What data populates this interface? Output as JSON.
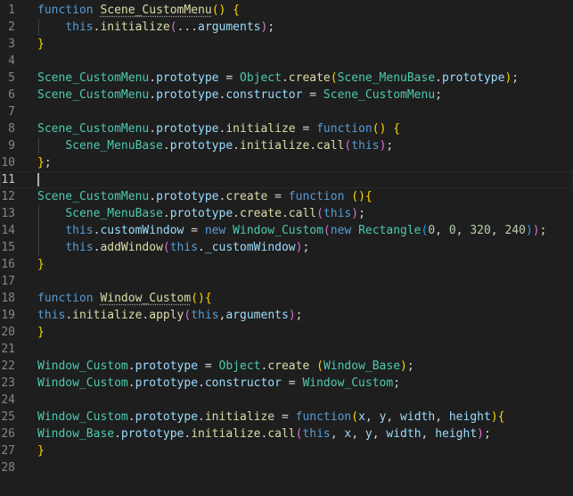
{
  "editor": {
    "current_line": 11,
    "lines": [
      {
        "n": "1",
        "t": [
          [
            "function ",
            "kw"
          ],
          [
            "Scene_CustomMenu",
            "fn dotted"
          ],
          [
            "(",
            "br1"
          ],
          [
            ")",
            "br1"
          ],
          [
            " ",
            "pun"
          ],
          [
            "{",
            "br1"
          ]
        ]
      },
      {
        "n": "2",
        "indent": 1,
        "t": [
          [
            "    ",
            "pun"
          ],
          [
            "this",
            "kw"
          ],
          [
            ".",
            "pun"
          ],
          [
            "initialize",
            "fn"
          ],
          [
            "(",
            "br2"
          ],
          [
            "...",
            "pun"
          ],
          [
            "arguments",
            "prop"
          ],
          [
            ")",
            "br2"
          ],
          [
            ";",
            "pun"
          ]
        ]
      },
      {
        "n": "3",
        "t": [
          [
            "}",
            "br1"
          ]
        ]
      },
      {
        "n": "4",
        "t": []
      },
      {
        "n": "5",
        "t": [
          [
            "Scene_CustomMenu",
            "cls"
          ],
          [
            ".",
            "pun"
          ],
          [
            "prototype",
            "prop"
          ],
          [
            " = ",
            "pun"
          ],
          [
            "Object",
            "cls"
          ],
          [
            ".",
            "pun"
          ],
          [
            "create",
            "fn"
          ],
          [
            "(",
            "br1"
          ],
          [
            "Scene_MenuBase",
            "cls"
          ],
          [
            ".",
            "pun"
          ],
          [
            "prototype",
            "prop"
          ],
          [
            ")",
            "br1"
          ],
          [
            ";",
            "pun"
          ]
        ]
      },
      {
        "n": "6",
        "t": [
          [
            "Scene_CustomMenu",
            "cls"
          ],
          [
            ".",
            "pun"
          ],
          [
            "prototype",
            "prop"
          ],
          [
            ".",
            "pun"
          ],
          [
            "constructor",
            "prop"
          ],
          [
            " = ",
            "pun"
          ],
          [
            "Scene_CustomMenu",
            "cls"
          ],
          [
            ";",
            "pun"
          ]
        ]
      },
      {
        "n": "7",
        "t": []
      },
      {
        "n": "8",
        "t": [
          [
            "Scene_CustomMenu",
            "cls"
          ],
          [
            ".",
            "pun"
          ],
          [
            "prototype",
            "prop"
          ],
          [
            ".",
            "pun"
          ],
          [
            "initialize",
            "fn"
          ],
          [
            " = ",
            "pun"
          ],
          [
            "function",
            "kw"
          ],
          [
            "(",
            "br1"
          ],
          [
            ")",
            "br1"
          ],
          [
            " ",
            "pun"
          ],
          [
            "{",
            "br1"
          ]
        ]
      },
      {
        "n": "9",
        "indent": 1,
        "t": [
          [
            "    ",
            "pun"
          ],
          [
            "Scene_MenuBase",
            "cls"
          ],
          [
            ".",
            "pun"
          ],
          [
            "prototype",
            "prop"
          ],
          [
            ".",
            "pun"
          ],
          [
            "initialize",
            "fn"
          ],
          [
            ".",
            "pun"
          ],
          [
            "call",
            "fn"
          ],
          [
            "(",
            "br2"
          ],
          [
            "this",
            "kw"
          ],
          [
            ")",
            "br2"
          ],
          [
            ";",
            "pun"
          ]
        ]
      },
      {
        "n": "10",
        "t": [
          [
            "}",
            "br1"
          ],
          [
            ";",
            "pun"
          ]
        ]
      },
      {
        "n": "11",
        "cursor": true,
        "t": []
      },
      {
        "n": "12",
        "t": [
          [
            "Scene_CustomMenu",
            "cls"
          ],
          [
            ".",
            "pun"
          ],
          [
            "prototype",
            "prop"
          ],
          [
            ".",
            "pun"
          ],
          [
            "create",
            "fn"
          ],
          [
            " = ",
            "pun"
          ],
          [
            "function",
            "kw"
          ],
          [
            " ",
            "pun"
          ],
          [
            "(",
            "br1"
          ],
          [
            ")",
            "br1"
          ],
          [
            "{",
            "br1"
          ]
        ]
      },
      {
        "n": "13",
        "indent": 1,
        "t": [
          [
            "    ",
            "pun"
          ],
          [
            "Scene_MenuBase",
            "cls"
          ],
          [
            ".",
            "pun"
          ],
          [
            "prototype",
            "prop"
          ],
          [
            ".",
            "pun"
          ],
          [
            "create",
            "fn"
          ],
          [
            ".",
            "pun"
          ],
          [
            "call",
            "fn"
          ],
          [
            "(",
            "br2"
          ],
          [
            "this",
            "kw"
          ],
          [
            ")",
            "br2"
          ],
          [
            ";",
            "pun"
          ]
        ]
      },
      {
        "n": "14",
        "indent": 1,
        "t": [
          [
            "    ",
            "pun"
          ],
          [
            "this",
            "kw"
          ],
          [
            ".",
            "pun"
          ],
          [
            "customWindow",
            "prop"
          ],
          [
            " = ",
            "pun"
          ],
          [
            "new ",
            "kw"
          ],
          [
            "Window_Custom",
            "cls"
          ],
          [
            "(",
            "br2"
          ],
          [
            "new ",
            "kw"
          ],
          [
            "Rectangle",
            "cls"
          ],
          [
            "(",
            "br3"
          ],
          [
            "0",
            "num"
          ],
          [
            ", ",
            "pun"
          ],
          [
            "0",
            "num"
          ],
          [
            ", ",
            "pun"
          ],
          [
            "320",
            "num"
          ],
          [
            ", ",
            "pun"
          ],
          [
            "240",
            "num"
          ],
          [
            ")",
            "br3"
          ],
          [
            ")",
            "br2"
          ],
          [
            ";",
            "pun"
          ]
        ]
      },
      {
        "n": "15",
        "indent": 1,
        "t": [
          [
            "    ",
            "pun"
          ],
          [
            "this",
            "kw"
          ],
          [
            ".",
            "pun"
          ],
          [
            "addWindow",
            "fn"
          ],
          [
            "(",
            "br2"
          ],
          [
            "this",
            "kw"
          ],
          [
            ".",
            "pun"
          ],
          [
            "_customWindow",
            "prop"
          ],
          [
            ")",
            "br2"
          ],
          [
            ";",
            "pun"
          ]
        ]
      },
      {
        "n": "16",
        "t": [
          [
            "}",
            "br1"
          ]
        ]
      },
      {
        "n": "17",
        "t": []
      },
      {
        "n": "18",
        "t": [
          [
            "function ",
            "kw"
          ],
          [
            "Window_Custom",
            "fn dotted"
          ],
          [
            "(",
            "br1"
          ],
          [
            ")",
            "br1"
          ],
          [
            "{",
            "br1"
          ]
        ]
      },
      {
        "n": "19",
        "t": [
          [
            "this",
            "kw"
          ],
          [
            ".",
            "pun"
          ],
          [
            "initialize",
            "fn"
          ],
          [
            ".",
            "pun"
          ],
          [
            "apply",
            "fn"
          ],
          [
            "(",
            "br2"
          ],
          [
            "this",
            "kw"
          ],
          [
            ",",
            "pun"
          ],
          [
            "arguments",
            "prop"
          ],
          [
            ")",
            "br2"
          ],
          [
            ";",
            "pun"
          ]
        ]
      },
      {
        "n": "20",
        "t": [
          [
            "}",
            "br1"
          ]
        ]
      },
      {
        "n": "21",
        "t": []
      },
      {
        "n": "22",
        "t": [
          [
            "Window_Custom",
            "cls"
          ],
          [
            ".",
            "pun"
          ],
          [
            "prototype",
            "prop"
          ],
          [
            " = ",
            "pun"
          ],
          [
            "Object",
            "cls"
          ],
          [
            ".",
            "pun"
          ],
          [
            "create",
            "fn"
          ],
          [
            " ",
            "pun"
          ],
          [
            "(",
            "br1"
          ],
          [
            "Window_Base",
            "cls"
          ],
          [
            ")",
            "br1"
          ],
          [
            ";",
            "pun"
          ]
        ]
      },
      {
        "n": "23",
        "t": [
          [
            "Window_Custom",
            "cls"
          ],
          [
            ".",
            "pun"
          ],
          [
            "prototype",
            "prop"
          ],
          [
            ".",
            "pun"
          ],
          [
            "constructor",
            "prop"
          ],
          [
            " = ",
            "pun"
          ],
          [
            "Window_Custom",
            "cls"
          ],
          [
            ";",
            "pun"
          ]
        ]
      },
      {
        "n": "24",
        "t": []
      },
      {
        "n": "25",
        "t": [
          [
            "Window_Custom",
            "cls"
          ],
          [
            ".",
            "pun"
          ],
          [
            "prototype",
            "prop"
          ],
          [
            ".",
            "pun"
          ],
          [
            "initialize",
            "fn"
          ],
          [
            " = ",
            "pun"
          ],
          [
            "function",
            "kw"
          ],
          [
            "(",
            "br1"
          ],
          [
            "x",
            "prop"
          ],
          [
            ", ",
            "pun"
          ],
          [
            "y",
            "prop"
          ],
          [
            ", ",
            "pun"
          ],
          [
            "width",
            "prop"
          ],
          [
            ", ",
            "pun"
          ],
          [
            "height",
            "prop"
          ],
          [
            ")",
            "br1"
          ],
          [
            "{",
            "br1"
          ]
        ]
      },
      {
        "n": "26",
        "t": [
          [
            "Window_Base",
            "cls"
          ],
          [
            ".",
            "pun"
          ],
          [
            "prototype",
            "prop"
          ],
          [
            ".",
            "pun"
          ],
          [
            "initialize",
            "fn"
          ],
          [
            ".",
            "pun"
          ],
          [
            "call",
            "fn"
          ],
          [
            "(",
            "br2"
          ],
          [
            "this",
            "kw"
          ],
          [
            ", ",
            "pun"
          ],
          [
            "x",
            "prop"
          ],
          [
            ", ",
            "pun"
          ],
          [
            "y",
            "prop"
          ],
          [
            ", ",
            "pun"
          ],
          [
            "width",
            "prop"
          ],
          [
            ", ",
            "pun"
          ],
          [
            "height",
            "prop"
          ],
          [
            ")",
            "br2"
          ],
          [
            ";",
            "pun"
          ]
        ]
      },
      {
        "n": "27",
        "t": [
          [
            "}",
            "br1"
          ]
        ]
      },
      {
        "n": "28",
        "t": []
      }
    ]
  }
}
